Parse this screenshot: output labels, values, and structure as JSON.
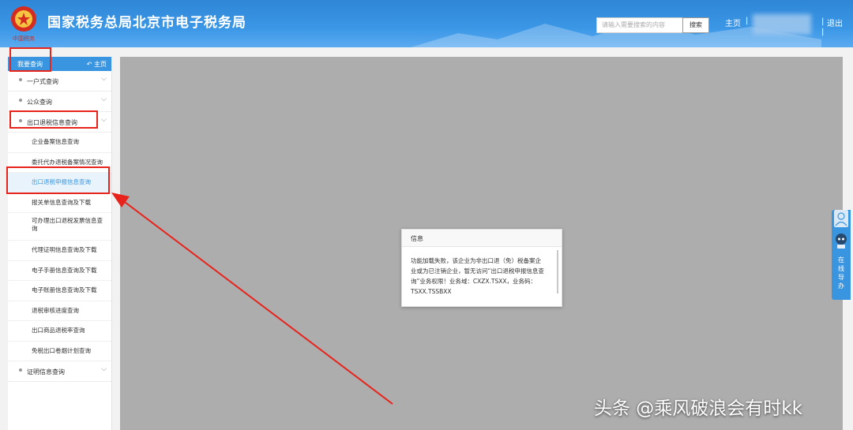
{
  "header": {
    "emblem_caption": "中国税务",
    "title": "国家税务总局北京市电子税务局",
    "search_placeholder": "请输入需要搜索的内容",
    "search_button": "搜索",
    "nav_home": "主页",
    "separator": "|",
    "logout": "退出"
  },
  "sidebar": {
    "heading": "我要查询",
    "home_link": "主页",
    "menu": [
      {
        "label": "一户式查询"
      },
      {
        "label": "公众查询"
      },
      {
        "label": "出口退税信息查询"
      }
    ],
    "sub_items": [
      "企业备案信息查询",
      "委托代办退税备案情况查询",
      "出口退税申报信息查询",
      "报关单信息查询及下载",
      "可办理出口退税发票信息查询",
      "代理证明信息查询及下载",
      "电子手册信息查询及下载",
      "电子账册信息查询及下载",
      "退税审核进度查询",
      "出口商品退税率查询",
      "免税出口卷烟计划查询"
    ],
    "last_menu": {
      "label": "证明信息查询"
    }
  },
  "dialog": {
    "title": "信息",
    "message": "功能加载失败，该企业为非出口退（免）税备案企业或为已注销企业，暂无访问“出口退税申报信息查询”业务权限！业务域：CXZX.TSXX，业务码：TSXX.TSSBXX"
  },
  "float_tab": {
    "label": "在线导办",
    "icon_top": "person-icon",
    "icon_mid": "robot-icon"
  },
  "watermark": "头条 @乘风破浪会有时kk",
  "colors": {
    "primary": "#3a95e0",
    "annotation": "#e8231c",
    "content_bg": "#adadad"
  }
}
